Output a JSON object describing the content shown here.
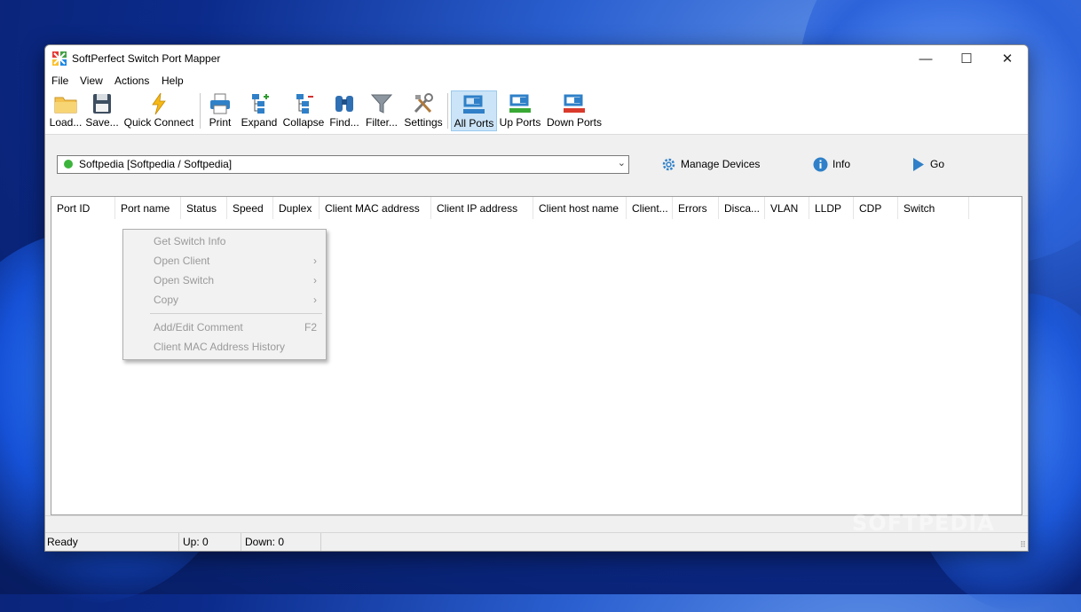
{
  "window": {
    "title": "SoftPerfect Switch Port Mapper"
  },
  "controls": {
    "minimize": "—",
    "maximize": "☐",
    "close": "✕"
  },
  "menu": [
    "File",
    "View",
    "Actions",
    "Help"
  ],
  "toolbar": {
    "load": "Load...",
    "save": "Save...",
    "quick_connect": "Quick Connect",
    "print": "Print",
    "expand": "Expand",
    "collapse": "Collapse",
    "find": "Find...",
    "filter": "Filter...",
    "settings": "Settings",
    "all_ports": "All Ports",
    "up_ports": "Up Ports",
    "down_ports": "Down Ports",
    "active": "All Ports"
  },
  "device": {
    "selected": "Softpedia [Softpedia / Softpedia]",
    "status_color": "#3cb43c",
    "manage_devices": "Manage Devices",
    "info": "Info",
    "go": "Go"
  },
  "table": {
    "columns": [
      "Port ID",
      "Port name",
      "Status",
      "Speed",
      "Duplex",
      "Client MAC address",
      "Client IP address",
      "Client host name",
      "Client...",
      "Errors",
      "Disca...",
      "VLAN",
      "LLDP",
      "CDP",
      "Switch"
    ],
    "rows": []
  },
  "context_menu": [
    {
      "label": "Get Switch Info",
      "submenu": false,
      "shortcut": ""
    },
    {
      "label": "Open Client",
      "submenu": true,
      "shortcut": ""
    },
    {
      "label": "Open Switch",
      "submenu": true,
      "shortcut": ""
    },
    {
      "label": "Copy",
      "submenu": true,
      "shortcut": ""
    },
    {
      "label": "Add/Edit Comment",
      "submenu": false,
      "shortcut": "F2"
    },
    {
      "label": "Client MAC Address History",
      "submenu": false,
      "shortcut": ""
    }
  ],
  "status": {
    "ready": "Ready",
    "up": "Up: 0",
    "down": "Down: 0"
  },
  "watermark": "SOFTPEDIA"
}
